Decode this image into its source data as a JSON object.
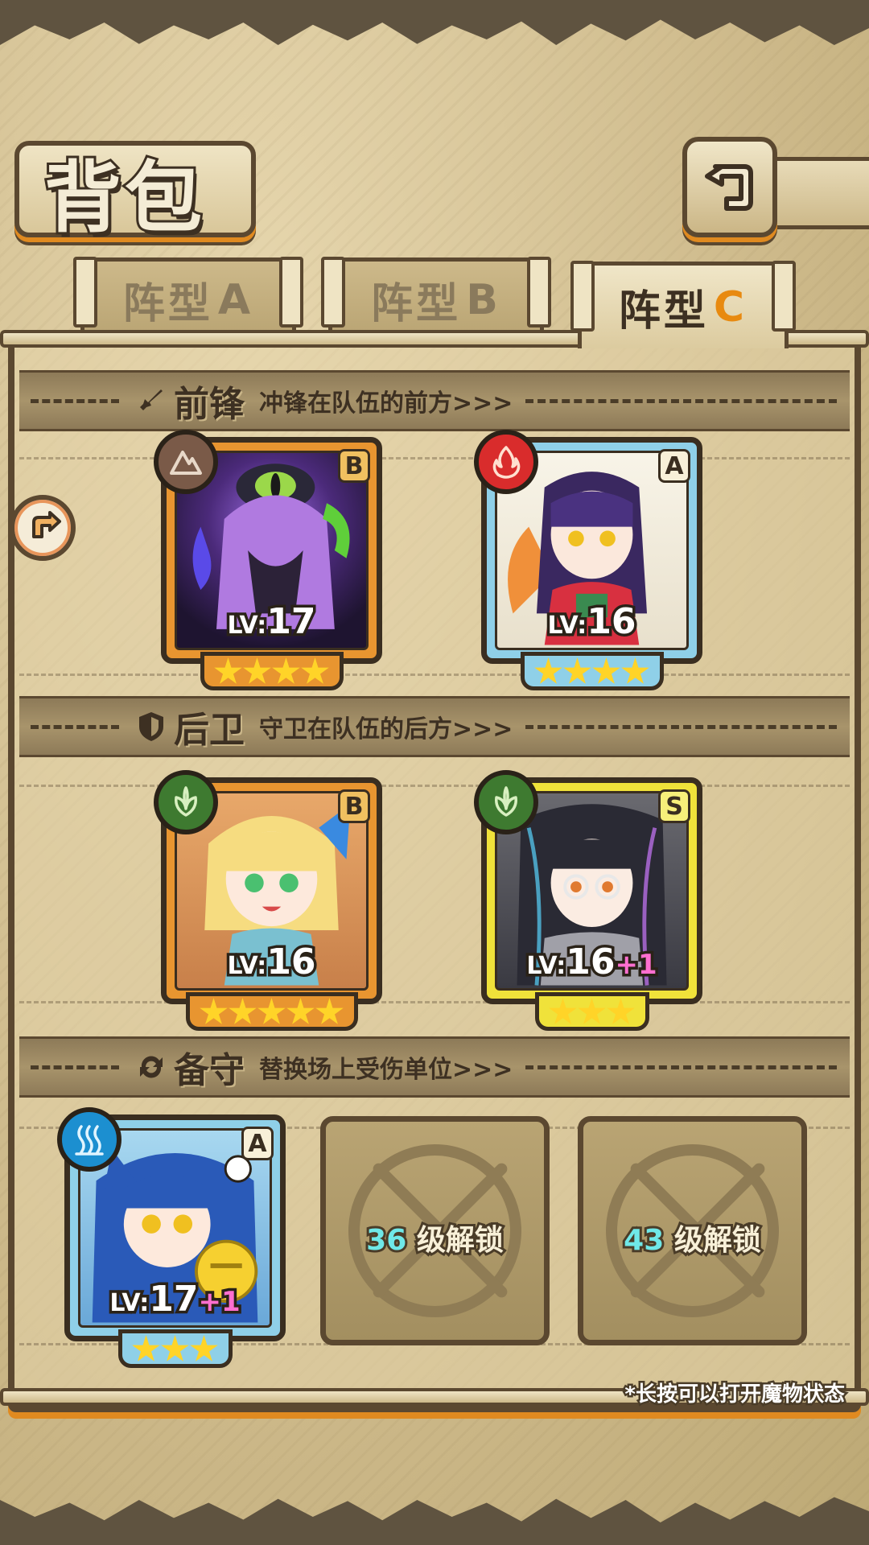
{
  "header": {
    "title": "背包",
    "back_icon": "back-return-icon"
  },
  "tabs": [
    {
      "label": "阵型",
      "letter": "A",
      "active": false
    },
    {
      "label": "阵型",
      "letter": "B",
      "active": false
    },
    {
      "label": "阵型",
      "letter": "C",
      "active": true
    }
  ],
  "sections": {
    "front": {
      "icon": "sword-icon",
      "name": "前锋",
      "desc": "冲锋在队伍的前方>>>"
    },
    "back": {
      "icon": "shield-icon",
      "name": "后卫",
      "desc": "守卫在队伍的后方>>>"
    },
    "reserve": {
      "icon": "swap-icon",
      "name": "备守",
      "desc": "替换场上受伤单位>>>"
    }
  },
  "units": {
    "front_1": {
      "element": "earth-element-icon",
      "rank": "B",
      "lv_label": "LV:",
      "level": "17",
      "plus": "",
      "stars": 4,
      "frame_color": "#e89530"
    },
    "front_2": {
      "element": "fire-element-icon",
      "rank": "A",
      "lv_label": "LV:",
      "level": "16",
      "plus": "",
      "stars": 4,
      "frame_color": "#8fd0e8"
    },
    "back_1": {
      "element": "leaf-element-icon",
      "rank": "B",
      "lv_label": "LV:",
      "level": "16",
      "plus": "",
      "stars": 5,
      "frame_color": "#e89530"
    },
    "back_2": {
      "element": "leaf-element-icon",
      "rank": "S",
      "lv_label": "LV:",
      "level": "16",
      "plus": "+1",
      "stars": 3,
      "frame_color": "#f0e23a"
    },
    "reserve_1": {
      "element": "water-element-icon",
      "rank": "A",
      "lv_label": "LV:",
      "level": "17",
      "plus": "+1",
      "stars": 3,
      "frame_color": "#8fd0e8"
    }
  },
  "locked_slots": [
    {
      "level": "36",
      "text": "级解锁"
    },
    {
      "level": "43",
      "text": "级解锁"
    }
  ],
  "hint": "*长按可以打开魔物状态"
}
